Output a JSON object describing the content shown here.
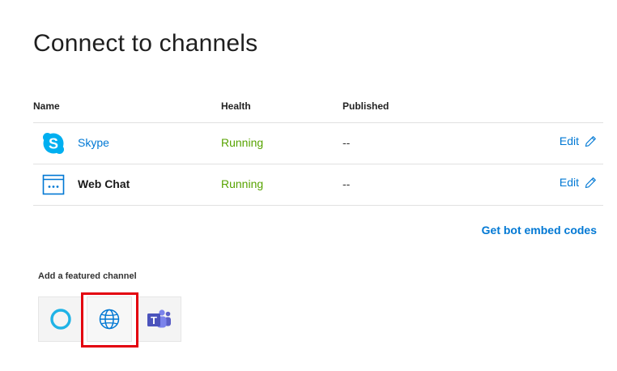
{
  "page": {
    "title": "Connect to channels"
  },
  "table": {
    "headers": {
      "name": "Name",
      "health": "Health",
      "published": "Published"
    },
    "rows": [
      {
        "icon": "skype-icon",
        "name": "Skype",
        "health": "Running",
        "published": "--",
        "edit_label": "Edit"
      },
      {
        "icon": "web-chat-icon",
        "name": "Web Chat",
        "health": "Running",
        "published": "--",
        "edit_label": "Edit"
      }
    ]
  },
  "embed_link": "Get bot embed codes",
  "featured": {
    "label": "Add a featured channel",
    "channels": [
      {
        "icon": "cortana-icon"
      },
      {
        "icon": "globe-icon",
        "highlighted": true
      },
      {
        "icon": "teams-icon"
      }
    ]
  },
  "colors": {
    "accent": "#0078d4",
    "running": "#57a300",
    "highlight": "#e3000f",
    "skype": "#00aff0",
    "cortana": "#1fb3e6",
    "teams": "#5b5fc7"
  }
}
